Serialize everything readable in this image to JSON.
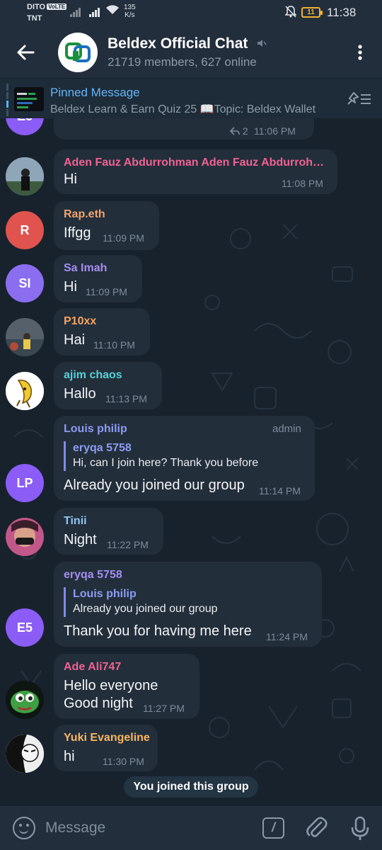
{
  "status_bar": {
    "carrier_1": "DITO",
    "volte": "VoLTE",
    "carrier_2": "TNT",
    "net_speed_value": "135",
    "net_speed_unit": "K/s",
    "battery": "11",
    "time": "11:38"
  },
  "header": {
    "title": "Beldex Official Chat",
    "subtitle": "21719 members, 627 online"
  },
  "pinned": {
    "label": "Pinned Message",
    "text": "Beldex Learn & Earn Quiz 25  📖Topic: Beldex Wallet"
  },
  "messages": [
    {
      "avatar_initials": "E5",
      "avatar_color": "#8b5cf6",
      "reply_count": "2",
      "time": "11:06 PM"
    },
    {
      "sender": "Aden Fauz Abdurrohman Aden Fauz Abdurrohman",
      "sender_color": "#f06292",
      "text": "Hi",
      "time": "11:08 PM"
    },
    {
      "sender": "Rap.eth",
      "sender_color": "#f4a36b",
      "avatar_initials": "R",
      "avatar_color": "#e0534e",
      "text": "Iffgg",
      "time": "11:09 PM"
    },
    {
      "sender": "Sa Imah",
      "sender_color": "#a48ef2",
      "avatar_initials": "SI",
      "avatar_color": "#8b6ef0",
      "text": "Hi",
      "time": "11:09 PM"
    },
    {
      "sender": "P10xx",
      "sender_color": "#f6a45f",
      "text": "Hai",
      "time": "11:10 PM"
    },
    {
      "sender": "ajim chaos",
      "sender_color": "#56d1d6",
      "text": "Hallo",
      "time": "11:13 PM"
    },
    {
      "sender": "Louis philip",
      "sender_color": "#8c9bf2",
      "badge": "admin",
      "avatar_initials": "LP",
      "avatar_color": "#8b5cf6",
      "reply_name": "eryqa 5758",
      "reply_text": "Hi, can I join here? Thank you before",
      "text": "Already you joined our group",
      "time": "11:14 PM"
    },
    {
      "sender": "Tinii",
      "sender_color": "#8cc8f2",
      "text": "Night",
      "time": "11:22 PM"
    },
    {
      "sender": "eryqa 5758",
      "sender_color": "#a48ef2",
      "avatar_initials": "E5",
      "avatar_color": "#8b5cf6",
      "reply_name": "Louis philip",
      "reply_text": "Already you joined our group",
      "text": "Thank you for having me here",
      "time": "11:24 PM"
    },
    {
      "sender": "Ade Ali747",
      "sender_color": "#f06292",
      "text_line1": "Hello everyone",
      "text_line2": "Good night",
      "time": "11:27 PM"
    },
    {
      "sender": "Yuki Evangeline",
      "sender_color": "#f6b65f",
      "text": "hi",
      "time": "11:30 PM"
    }
  ],
  "service_message": "You joined this group",
  "input": {
    "placeholder": "Message"
  },
  "icons": [
    "back-arrow-icon",
    "mute-icon",
    "more-vert-icon",
    "unpin-icon",
    "reply-icon",
    "emoji-icon",
    "bot-command-icon",
    "attach-icon",
    "mic-icon"
  ]
}
